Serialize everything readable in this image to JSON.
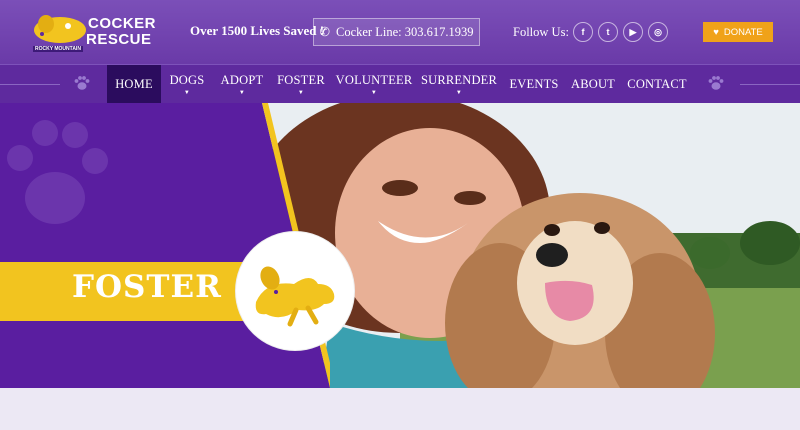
{
  "header": {
    "logo_word1": "COCKER",
    "logo_word2": "RESCUE",
    "logo_tag": "ROCKY MOUNTAIN",
    "lives_saved": "Over 1500 Lives Saved !",
    "phone_label": "Cocker Line: 303.617.1939",
    "follow_label": "Follow Us:",
    "social": [
      "f",
      "t",
      "▶",
      "◎"
    ],
    "donate_label": "DONATE"
  },
  "nav": {
    "items": [
      {
        "label": "HOME"
      },
      {
        "label": "DOGS"
      },
      {
        "label": "ADOPT"
      },
      {
        "label": "FOSTER"
      },
      {
        "label": "VOLUNTEER"
      },
      {
        "label": "SURRENDER"
      },
      {
        "label": "EVENTS"
      },
      {
        "label": "ABOUT"
      },
      {
        "label": "CONTACT"
      }
    ]
  },
  "hero": {
    "title": "FOSTER"
  },
  "colors": {
    "header_purple": "#6a3aa8",
    "nav_purple": "#5e2a9e",
    "nav_active": "#2b0c5e",
    "accent_yellow": "#f2c41f",
    "donate_orange": "#f0a219"
  }
}
